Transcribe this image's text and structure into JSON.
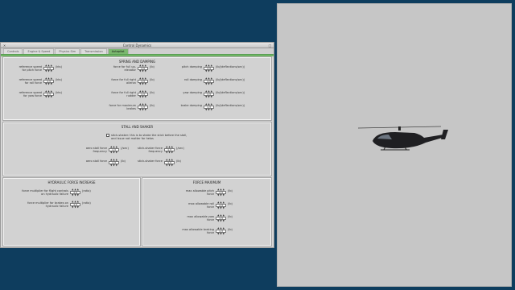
{
  "window": {
    "title": "Control Dynamics"
  },
  "tabs": [
    "Controls",
    "Engine & Speed",
    "Physics Sim",
    "Transmission",
    "Autopilot"
  ],
  "active_tab": 4,
  "panels": {
    "spring": {
      "title": "SPRING AND DAMPING",
      "rows": [
        {
          "label": "reference speed for pitch force",
          "value": "1.3",
          "unit": "(kts)"
        },
        {
          "label": "reference speed for roll force",
          "value": "1.3",
          "unit": "(kts)"
        },
        {
          "label": "reference speed for yaw force",
          "value": "1.3",
          "unit": "(kts)"
        },
        {
          "label": "force for full up-elevator",
          "value": "1.3",
          "unit": "(lb)"
        },
        {
          "label": "force for full right aileron",
          "value": "1.3",
          "unit": "(lb)"
        },
        {
          "label": "force for full right rudder",
          "value": "1.3",
          "unit": "(lb)"
        },
        {
          "label": "force for maximum brakes",
          "value": "1.3",
          "unit": "(lb)"
        },
        {
          "label": "pitch damping",
          "value": "1.3",
          "unit": "(lb/(deflections/sec))"
        },
        {
          "label": "roll damping",
          "value": "1.3",
          "unit": "(lb/(deflections/sec))"
        },
        {
          "label": "yaw damping",
          "value": "1.3",
          "unit": "(lb/(deflections/sec))"
        },
        {
          "label": "brake damping",
          "value": "1.3",
          "unit": "(lb/(deflections/sec))"
        }
      ]
    },
    "stall": {
      "title": "STALL AND SHAKER",
      "checkbox_label": "stick-shaker: this is to shake the stick before the stall, and issue not matter for helos",
      "rows": [
        {
          "label": "aero stall force frequency",
          "value": "1.3",
          "unit": "(/sec)"
        },
        {
          "label": "aero stall force",
          "value": "1.3",
          "unit": "(lb)"
        },
        {
          "label": "stick-shaker force frequency",
          "value": "1.3",
          "unit": "(/sec)"
        },
        {
          "label": "stick-shaker force",
          "value": "1.3",
          "unit": "(lb)"
        }
      ]
    },
    "hydraulic": {
      "title": "HYDRAULIC FORCE INCREASE",
      "rows": [
        {
          "label": "force multiplier for flight controls on hydraulic failure",
          "value": "1.3",
          "unit": "(ratio)"
        },
        {
          "label": "force multiplier for brakes on hydraulic failure",
          "value": "1.3",
          "unit": "(ratio)"
        }
      ]
    },
    "force": {
      "title": "FORCE MAXIMUM",
      "rows": [
        {
          "label": "max allowable pitch force",
          "value": "1.3",
          "unit": "(lb)"
        },
        {
          "label": "max allowable roll force",
          "value": "1.3",
          "unit": "(lb)"
        },
        {
          "label": "max allowable yaw force",
          "value": "1.3",
          "unit": "(lb)"
        },
        {
          "label": "max allowable braking force",
          "value": "1.3",
          "unit": "(lb)"
        }
      ]
    }
  }
}
